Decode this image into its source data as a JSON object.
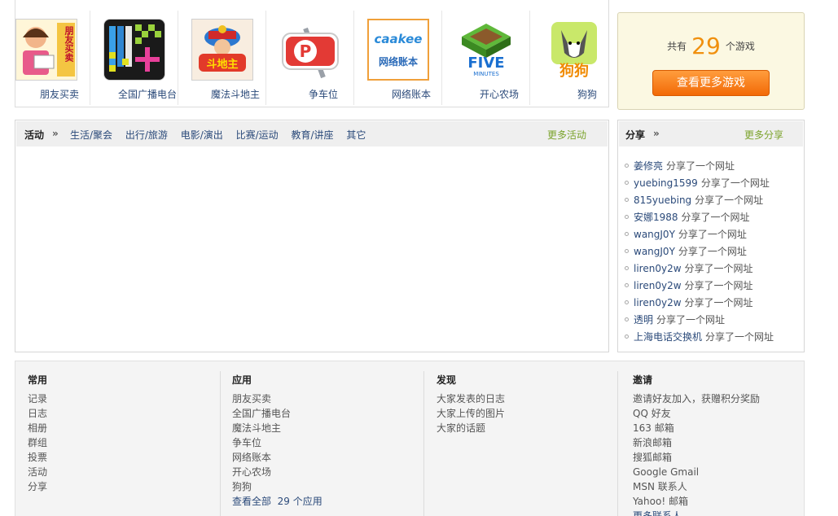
{
  "apps": [
    {
      "name": "朋友买卖",
      "thumb_text": "朋友买卖",
      "bg": "#f4c542"
    },
    {
      "name": "全国广播电台",
      "thumb_text": "",
      "bg": "#1d1d1d"
    },
    {
      "name": "魔法斗地主",
      "thumb_text": "斗地主",
      "bg": "#fff0e0"
    },
    {
      "name": "争车位",
      "thumb_text": "P",
      "bg": "#ffffff"
    },
    {
      "name": "网络账本",
      "thumb_text": "网络账本",
      "thumb_sub": "caakee",
      "bg": "#ffffff"
    },
    {
      "name": "开心农场",
      "thumb_text": "FIVE",
      "thumb_sub": "MINUTES",
      "bg": "#ffffff"
    },
    {
      "name": "狗狗",
      "thumb_text": "狗狗",
      "bg": "#ffffff"
    }
  ],
  "games": {
    "prefix": "共有",
    "count": "29",
    "suffix": "个游戏",
    "button": "查看更多游戏"
  },
  "activity": {
    "label": "活动",
    "arrow": "»",
    "tabs": [
      "生活/聚会",
      "出行/旅游",
      "电影/演出",
      "比赛/运动",
      "教育/讲座",
      "其它"
    ],
    "more": "更多活动"
  },
  "share": {
    "label": "分享",
    "arrow": "»",
    "more": "更多分享",
    "items": [
      {
        "user": "姜修亮",
        "action": "分享了一个网址"
      },
      {
        "user": "yuebing1599",
        "action": "分享了一个网址"
      },
      {
        "user": "815yuebing",
        "action": "分享了一个网址"
      },
      {
        "user": "安娜1988",
        "action": "分享了一个网址"
      },
      {
        "user": "wangJ0Y",
        "action": "分享了一个网址"
      },
      {
        "user": "wangJ0Y",
        "action": "分享了一个网址"
      },
      {
        "user": "liren0y2w",
        "action": "分享了一个网址"
      },
      {
        "user": "liren0y2w",
        "action": "分享了一个网址"
      },
      {
        "user": "liren0y2w",
        "action": "分享了一个网址"
      },
      {
        "user": "透明",
        "action": "分享了一个网址"
      },
      {
        "user": "上海电话交换机",
        "action": "分享了一个网址"
      }
    ]
  },
  "footer": {
    "common": {
      "title": "常用",
      "items": [
        "记录",
        "日志",
        "相册",
        "群组",
        "投票",
        "活动",
        "分享"
      ]
    },
    "apps": {
      "title": "应用",
      "items": [
        "朋友买卖",
        "全国广播电台",
        "魔法斗地主",
        "争车位",
        "网络账本",
        "开心农场",
        "狗狗"
      ],
      "all_link": "查看全部  29 个应用"
    },
    "discover": {
      "title": "发现",
      "items": [
        "大家发表的日志",
        "大家上传的图片",
        "大家的话题"
      ]
    },
    "invite": {
      "title": "邀请",
      "items": [
        "邀请好友加入，获赠积分奖励",
        "QQ 好友",
        "163 邮箱",
        "新浪邮箱",
        "搜狐邮箱",
        "Google Gmail",
        "MSN 联系人",
        "Yahoo! 邮箱",
        "更多联系人……"
      ]
    }
  }
}
